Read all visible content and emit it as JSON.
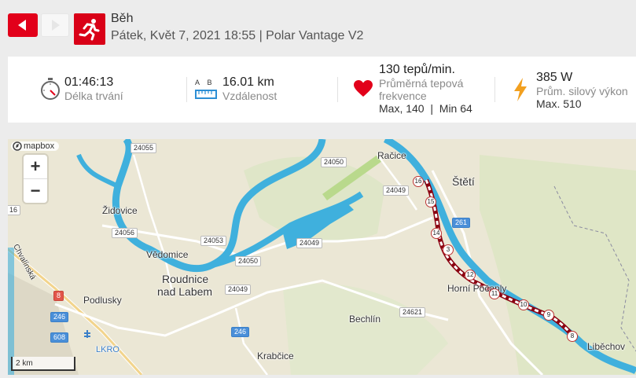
{
  "activity": {
    "title": "Běh",
    "subtitle": "Pátek, Květ 7, 2021 18:55 | Polar Vantage V2"
  },
  "stats": {
    "duration": {
      "value": "01:46:13",
      "label": "Délka trvání"
    },
    "distance": {
      "value": "16.01 km",
      "label": "Vzdálenost",
      "icon_text": "A    B"
    },
    "heart_rate": {
      "value": "130 tepů/min.",
      "label_line1": "Průměrná tepová",
      "label_line2": "frekvence",
      "sub": "Max, 140  |  Min 64"
    },
    "power": {
      "value": "385 W",
      "label": "Prům. silový výkon",
      "sub": "Max. 510"
    }
  },
  "map": {
    "attribution": "mapbox",
    "scale_label": "2 km",
    "zoom_in": "+",
    "zoom_out": "−",
    "places": {
      "racice": "Račice",
      "steti": "Štětí",
      "zidovice": "Židovice",
      "vedomice": "Vědomice",
      "roudnice_1": "Roudnice",
      "roudnice_2": "nad Labem",
      "podlusky": "Podlusky",
      "horni_pocaply": "Horní Počaply",
      "bechlin": "Bechlín",
      "krabcice": "Krabčice",
      "libechov": "Liběchov",
      "chvalinska": "Chvalínská",
      "airport": "LKRO"
    },
    "road_shields": {
      "r24055": "24055",
      "r24050a": "24050",
      "r24049a": "24049",
      "r16": "16",
      "r24056": "24056",
      "r24053": "24053",
      "r24050b": "24050",
      "r24049b": "24049",
      "r24049c": "24049",
      "r261": "261",
      "r8": "8",
      "r246a": "246",
      "r608": "608",
      "r246b": "246",
      "r24621": "24621"
    },
    "km_markers": [
      "16",
      "15",
      "14",
      "3",
      "12",
      "11",
      "10",
      "9",
      "8"
    ]
  },
  "colors": {
    "accent": "#e2001a",
    "river": "#3fb0dd",
    "route": "#d7001c"
  },
  "icons": {
    "prev": "chevron-left-icon",
    "next": "chevron-right-icon",
    "sport": "running-icon",
    "duration": "stopwatch-icon",
    "distance": "ruler-icon",
    "heart_rate": "heart-icon",
    "power": "lightning-icon"
  }
}
